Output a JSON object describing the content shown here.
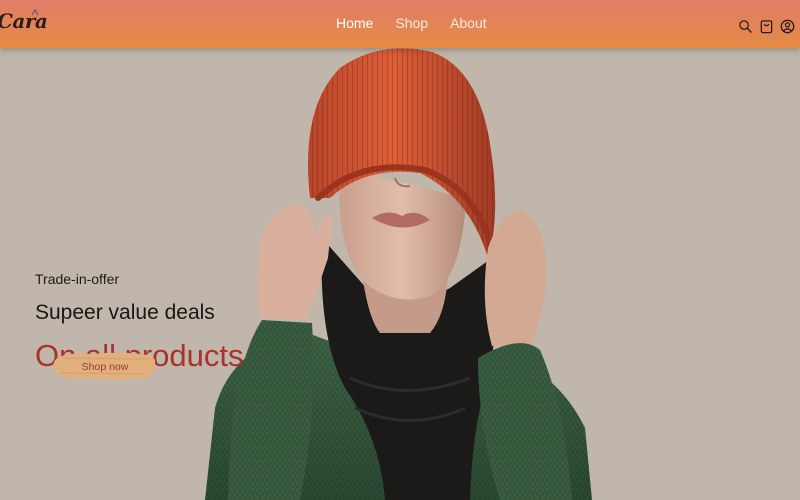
{
  "brand": {
    "logo_text": "Cara"
  },
  "nav": {
    "links": [
      {
        "label": "Home",
        "active": true
      },
      {
        "label": "Shop",
        "active": false
      },
      {
        "label": "About",
        "active": false
      }
    ],
    "icons": [
      "search-icon",
      "shopping-bag-icon",
      "user-icon"
    ]
  },
  "hero": {
    "eyebrow": "Trade-in-offer",
    "headline": "Supeer value deals",
    "highlight": "On all products",
    "cta_label": "Shop now"
  },
  "colors": {
    "nav_gradient_top": "#e07e69",
    "nav_gradient_bottom": "#e58a45",
    "hero_background": "#c0b6ab",
    "highlight_text": "#a8322c",
    "cta_background": "#e1b07e"
  }
}
